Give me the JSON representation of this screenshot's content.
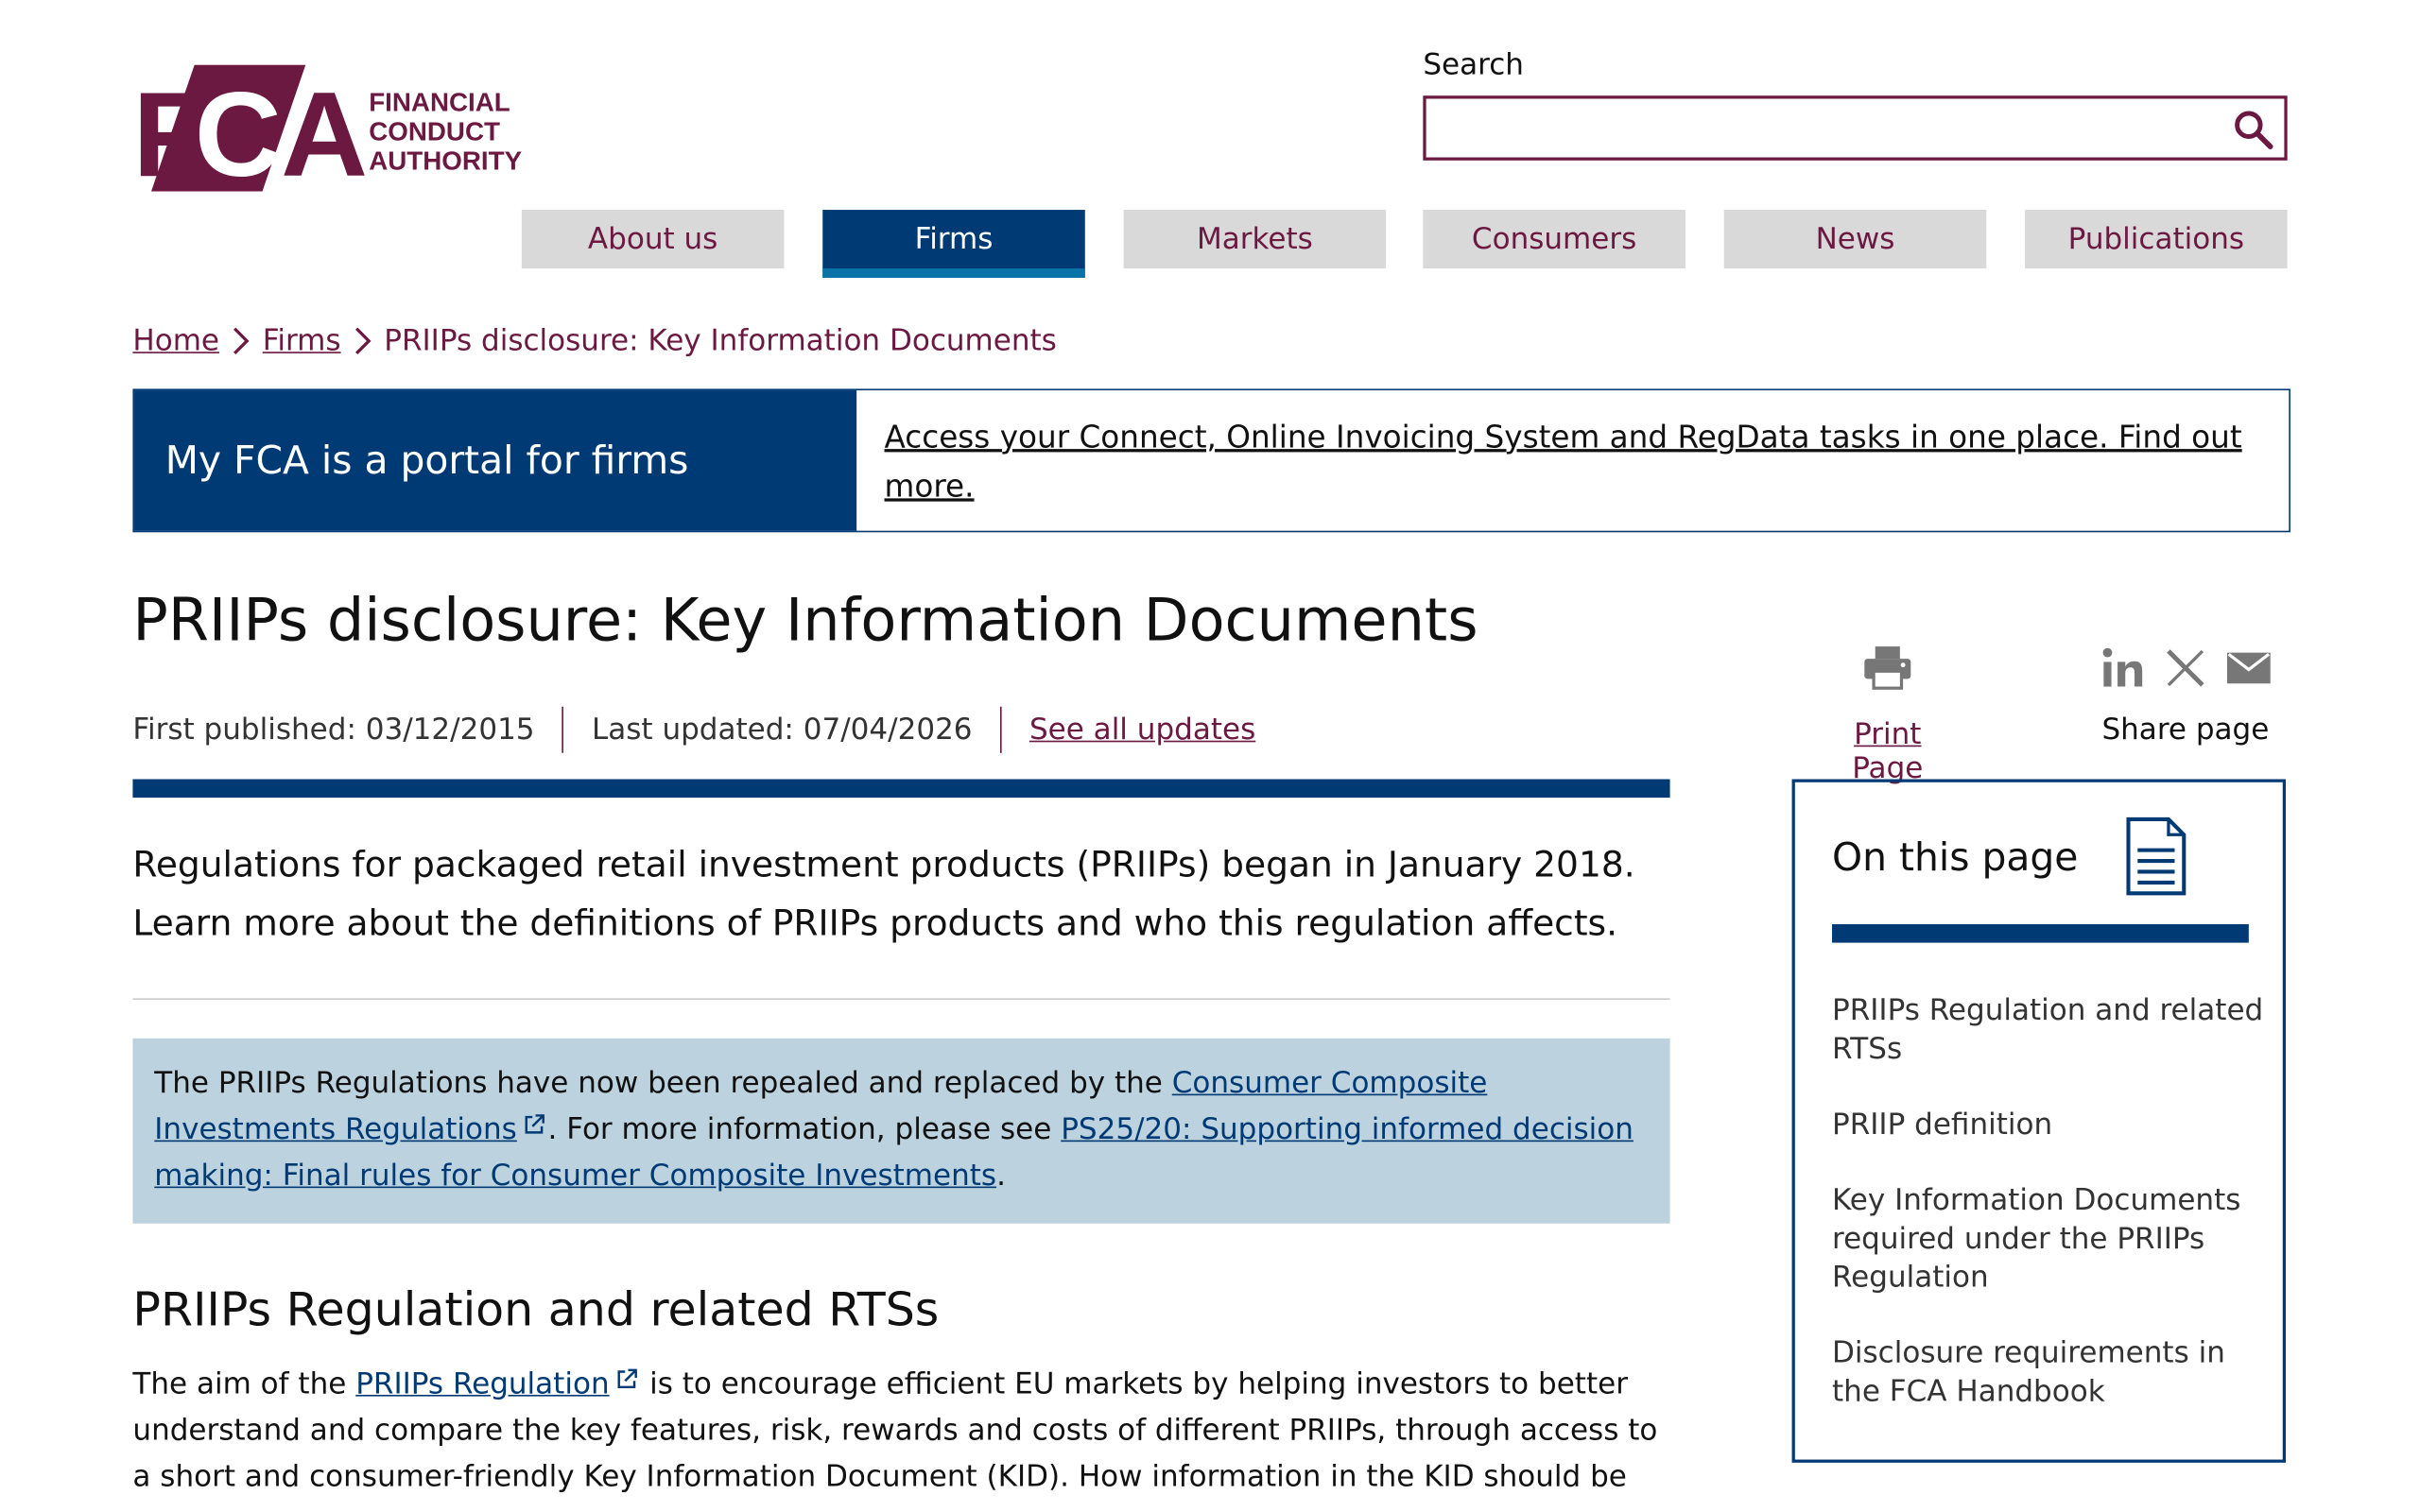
{
  "header": {
    "logo_text": "FCA",
    "logo_lines": [
      "FINANCIAL",
      "CONDUCT",
      "AUTHORITY"
    ],
    "search_label": "Search",
    "search_placeholder": ""
  },
  "nav": {
    "items": [
      {
        "label": "About us"
      },
      {
        "label": "Firms"
      },
      {
        "label": "Markets"
      },
      {
        "label": "Consumers"
      },
      {
        "label": "News"
      },
      {
        "label": "Publications"
      }
    ],
    "active": "Firms"
  },
  "breadcrumb": {
    "items": [
      {
        "label": "Home"
      },
      {
        "label": "Firms"
      }
    ],
    "current": "PRIIPs disclosure: Key Information Documents"
  },
  "portal": {
    "title": "My FCA is a portal for firms",
    "link": "Access your Connect, Online Invoicing System and RegData tasks in one place. Find out more."
  },
  "page": {
    "title": "PRIIPs disclosure: Key Information Documents",
    "first_published": "First published: 03/12/2015",
    "last_updated": "Last updated: 07/04/2026",
    "see_all_updates": "See all updates",
    "print_label": "Print Page",
    "share_label": "Share page",
    "intro": "Regulations for packaged retail investment products (PRIIPs) began in January 2018. Learn more about the definitions of PRIIPs products and who this regulation affects.",
    "notice": {
      "prefix": "The PRIIPs Regulations have now been repealed and replaced by the ",
      "link1": "Consumer Composite Investments Regulations",
      "middle": ". For more information, please see ",
      "link2": "PS25/20: Supporting informed decision making: Final rules for Consumer Composite Investments",
      "suffix": "."
    },
    "section_heading": "PRIIPs Regulation and related RTSs",
    "body": {
      "prefix": "The aim of the ",
      "link": "PRIIPs Regulation",
      "suffix": " is to encourage efficient EU markets by helping investors to better understand and compare the key features, risk, rewards and costs of different PRIIPs, through access to a short and consumer-friendly Key Information Document (KID). How information in the KID should be"
    }
  },
  "on_this_page": {
    "title": "On this page",
    "items": [
      {
        "label": "PRIIPs Regulation and related RTSs"
      },
      {
        "label": "PRIIP definition"
      },
      {
        "label": "Key Information Documents required under the PRIIPs Regulation"
      },
      {
        "label": "Disclosure requirements in the FCA Handbook"
      }
    ]
  },
  "colors": {
    "brand": "#6b1941",
    "navy": "#003a75",
    "notice_bg": "#bcd3df",
    "nav_bg": "#d9d9d9"
  },
  "icons": [
    "search-icon",
    "chevron-right-icon",
    "printer-icon",
    "linkedin-icon",
    "x-icon",
    "mail-icon",
    "document-icon",
    "external-link-icon"
  ]
}
